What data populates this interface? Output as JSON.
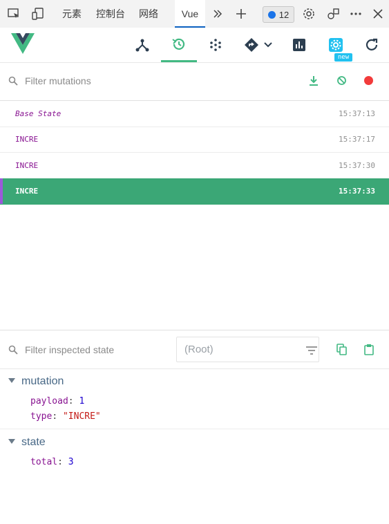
{
  "devtools": {
    "tabs": [
      "元素",
      "控制台",
      "网络",
      "Vue"
    ],
    "issues_count": "12"
  },
  "vue_toolbar": {
    "new_label": "new"
  },
  "mutations": {
    "filter_placeholder": "Filter mutations",
    "items": [
      {
        "name": "Base State",
        "time": "15:37:13"
      },
      {
        "name": "INCRE",
        "time": "15:37:17"
      },
      {
        "name": "INCRE",
        "time": "15:37:30"
      },
      {
        "name": "INCRE",
        "time": "15:37:33"
      }
    ]
  },
  "inspector": {
    "filter_placeholder": "Filter inspected state",
    "root_label": "(Root)",
    "mutation_header": "mutation",
    "mutation_props": [
      {
        "key": "payload",
        "value": "1"
      },
      {
        "key": "type",
        "value": "\"INCRE\""
      }
    ],
    "state_header": "state",
    "state_props": [
      {
        "key": "total",
        "value": "3"
      }
    ]
  },
  "colors": {
    "accent": "#42b983",
    "selected_row": "#3ba776",
    "record_dot": "#f23b3b"
  }
}
